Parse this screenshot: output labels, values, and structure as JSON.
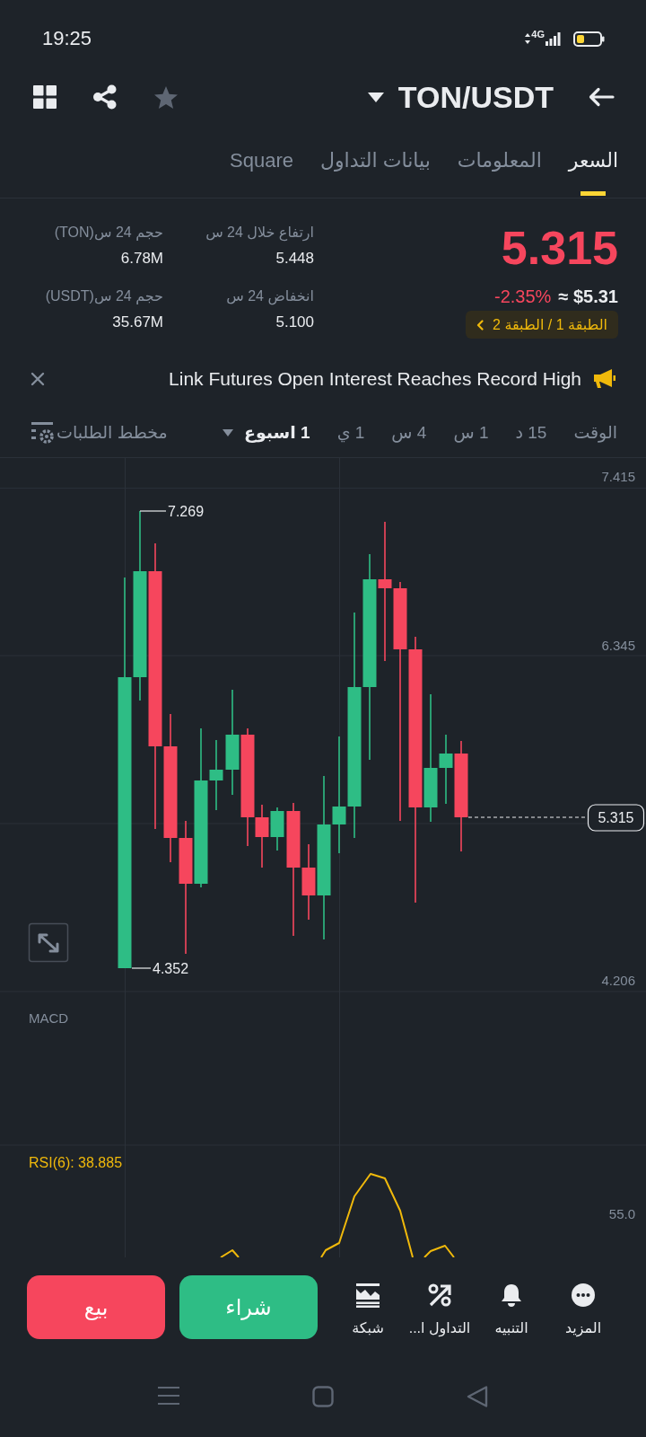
{
  "status_bar": {
    "time": "19:25",
    "network": "4G"
  },
  "header": {
    "pair": "TON/USDT",
    "favorite": false
  },
  "tabs": [
    {
      "label": "السعر",
      "selected": true
    },
    {
      "label": "المعلومات",
      "selected": false
    },
    {
      "label": "بيانات التداول",
      "selected": false
    },
    {
      "label": "Square",
      "selected": false
    }
  ],
  "price": {
    "last": "5.315",
    "falling": true,
    "change": "-2.35%",
    "usd_value": "≈ $5.31",
    "tag": "الطبقة 1 / الطبقة 2"
  },
  "stats": [
    {
      "label": "ارتفاع خلال 24 س",
      "value": "5.448"
    },
    {
      "label": "حجم 24 س(TON)",
      "value": "6.78M"
    },
    {
      "label": "انخفاض 24 س",
      "value": "5.100"
    },
    {
      "label": "حجم 24 س(USDT)",
      "value": "35.67M"
    }
  ],
  "announcement": {
    "text": "Link Futures Open Interest Reaches Record High"
  },
  "intervals": {
    "label": "الوقت",
    "items": [
      {
        "label": "15 د",
        "kind": "fixed",
        "selected": false
      },
      {
        "label": "1 س",
        "kind": "fixed",
        "selected": false
      },
      {
        "label": "4 س",
        "kind": "fixed",
        "selected": false
      },
      {
        "label": "1 ي",
        "kind": "fixed",
        "selected": false
      },
      {
        "label": "1 اسبوع",
        "kind": "menu",
        "selected": true
      }
    ],
    "depth_chart": "مخطط الطلبات"
  },
  "chart": {
    "price_ticks": [
      "7.415",
      "6.345",
      "4.206"
    ],
    "high": "7.269",
    "low": "4.352",
    "last": "5.315"
  },
  "macd": {
    "label": "MACD"
  },
  "rsi": {
    "label": "RSI(6): 38.885",
    "tick": "55.0"
  },
  "actions": [
    {
      "label": "المزيد",
      "kind": "more"
    },
    {
      "label": "التنبيه",
      "kind": "alert"
    },
    {
      "label": "التداول ا...",
      "kind": "trade"
    },
    {
      "label": "شبكة",
      "kind": "grid"
    }
  ],
  "buttons": [
    {
      "label": "شراء",
      "kind": "buy"
    },
    {
      "label": "بيع",
      "kind": "sell"
    }
  ]
}
